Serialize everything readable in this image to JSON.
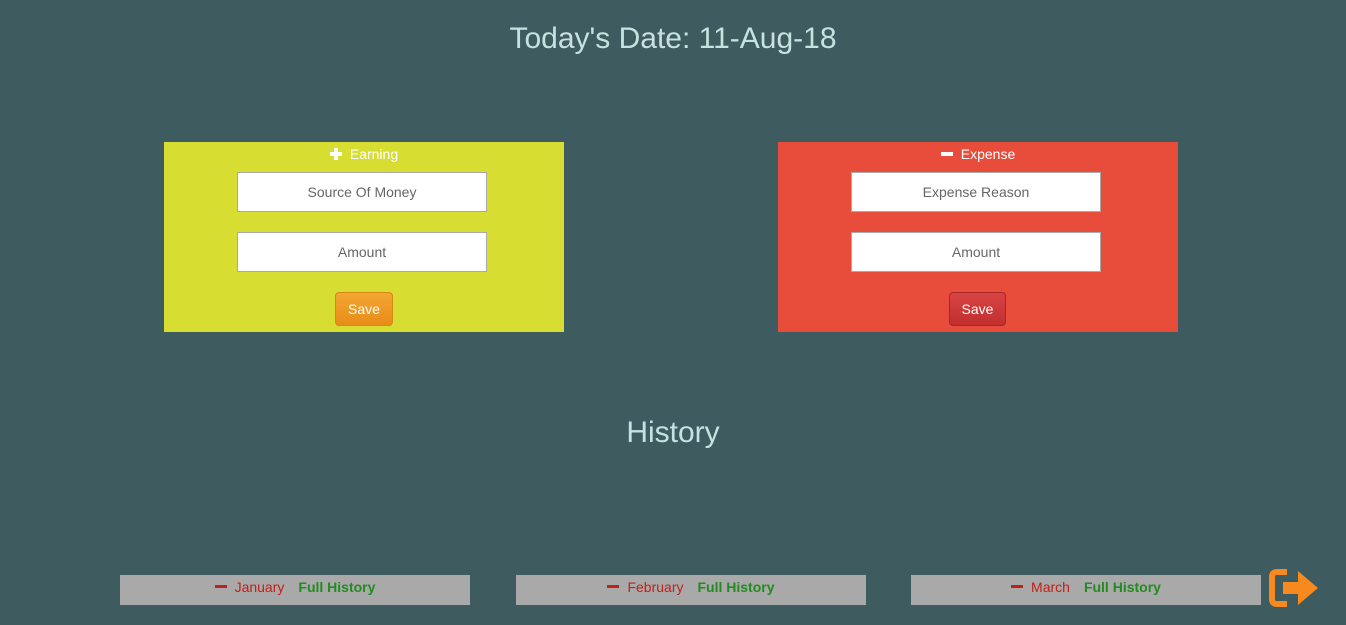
{
  "header": {
    "date_title": "Today's Date: 11-Aug-18"
  },
  "earning": {
    "title": "Earning",
    "icon": "plus-icon",
    "color": "#d8dd31",
    "source_placeholder": "Source Of Money",
    "amount_placeholder": "Amount",
    "save_label": "Save"
  },
  "expense": {
    "title": "Expense",
    "icon": "minus-icon",
    "color": "#e84c3b",
    "reason_placeholder": "Expense Reason",
    "amount_placeholder": "Amount",
    "save_label": "Save"
  },
  "history": {
    "title": "History",
    "months": [
      {
        "name": "January",
        "link": "Full History"
      },
      {
        "name": "February",
        "link": "Full History"
      },
      {
        "name": "March",
        "link": "Full History"
      }
    ]
  },
  "logout": {
    "icon": "logout-icon",
    "color": "#f7891f"
  },
  "colors": {
    "background": "#3e5b60",
    "title_text": "#c6e2e0",
    "month_bar": "#a9a9a9",
    "month_text": "#c0201c",
    "link_text": "#228b22"
  }
}
